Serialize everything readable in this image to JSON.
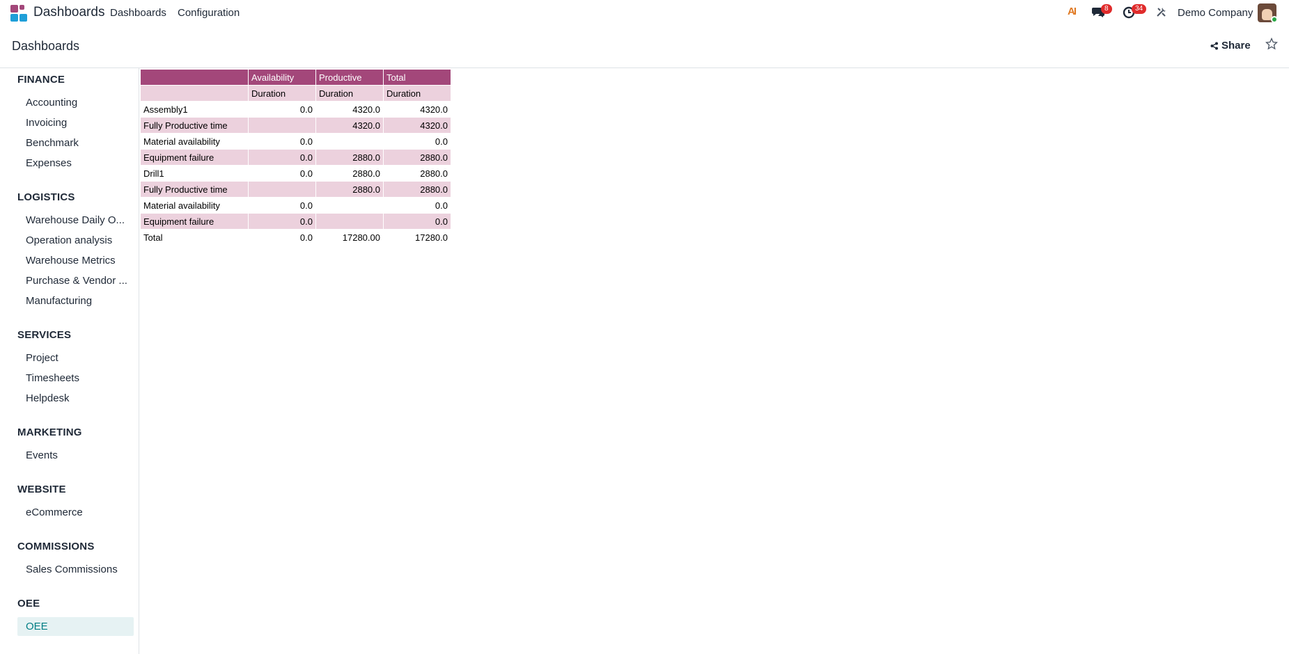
{
  "navbar": {
    "app_name": "Dashboards",
    "menu": [
      "Dashboards",
      "Configuration"
    ],
    "messages_count": "8",
    "activities_count": "34",
    "company": "Demo Company",
    "ai_label": "AI"
  },
  "control_panel": {
    "breadcrumb": "Dashboards",
    "share_label": "Share"
  },
  "sidebar": {
    "sections": [
      {
        "title": "FINANCE",
        "items": [
          "Accounting",
          "Invoicing",
          "Benchmark",
          "Expenses"
        ]
      },
      {
        "title": "LOGISTICS",
        "items": [
          "Warehouse Daily O...",
          "Operation analysis",
          "Warehouse Metrics",
          "Purchase & Vendor ...",
          "Manufacturing"
        ]
      },
      {
        "title": "SERVICES",
        "items": [
          "Project",
          "Timesheets",
          "Helpdesk"
        ]
      },
      {
        "title": "MARKETING",
        "items": [
          "Events"
        ]
      },
      {
        "title": "WEBSITE",
        "items": [
          "eCommerce"
        ]
      },
      {
        "title": "COMMISSIONS",
        "items": [
          "Sales Commissions"
        ]
      },
      {
        "title": "OEE",
        "items": [
          "OEE"
        ]
      }
    ],
    "active_item": "OEE"
  },
  "pivot": {
    "col_groups": [
      "",
      "Availability",
      "Productive",
      "Total"
    ],
    "measures": [
      "",
      "Duration",
      "Duration",
      "Duration"
    ],
    "rows": [
      [
        "Assembly1",
        "0.0",
        "4320.0",
        "4320.0"
      ],
      [
        "Fully Productive time",
        "",
        "4320.0",
        "4320.0"
      ],
      [
        "Material availability",
        "0.0",
        "",
        "0.0"
      ],
      [
        "Equipment failure",
        "0.0",
        "2880.0",
        "2880.0"
      ],
      [
        "Drill1",
        "0.0",
        "2880.0",
        "2880.0"
      ],
      [
        "Fully Productive time",
        "",
        "2880.0",
        "2880.0"
      ],
      [
        "Material availability",
        "0.0",
        "",
        "0.0"
      ],
      [
        "Equipment failure",
        "0.0",
        "",
        "0.0"
      ],
      [
        "Total",
        "0.0",
        "17280.00",
        "17280.0"
      ]
    ]
  },
  "colors": {
    "header_bg": "#a3477a",
    "stripe_bg": "#ecd1dd",
    "active_bg": "#e6f2f3",
    "active_text": "#017e84",
    "badge": "#e02c2c"
  }
}
